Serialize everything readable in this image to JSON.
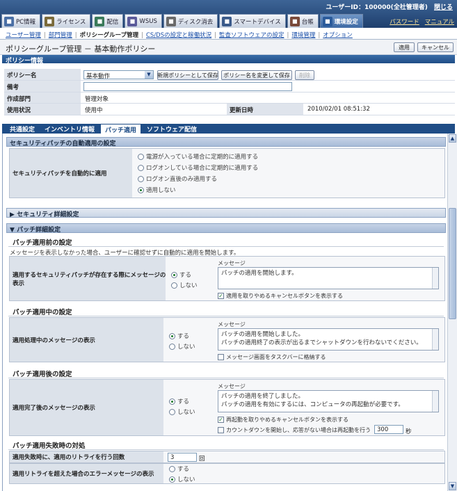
{
  "header": {
    "user_id": "ユーザーID：100000(全社管理者)",
    "close_link": "閉じる",
    "tabs": [
      {
        "label": "PC情報",
        "icon": "pc-icon",
        "color": "#4a6fa5"
      },
      {
        "label": "ライセンス",
        "icon": "license-icon",
        "color": "#7a6a3a"
      },
      {
        "label": "配信",
        "icon": "delivery-icon",
        "color": "#3a7a5a"
      },
      {
        "label": "WSUS",
        "icon": "wsus-icon",
        "color": "#5a5a9a"
      },
      {
        "label": "ディスク消去",
        "icon": "disk-erase-icon",
        "color": "#6a6a6a"
      },
      {
        "label": "スマートデバイス",
        "icon": "smart-device-icon",
        "color": "#3a5a8a"
      },
      {
        "label": "台帳",
        "icon": "ledger-icon",
        "color": "#7a4a3a"
      },
      {
        "label": "環境設定",
        "icon": "settings-icon",
        "color": "#2a5a9a"
      }
    ],
    "active_tab": "環境設定",
    "password_link": "パスワード",
    "manual_link": "マニュアル"
  },
  "subnav": {
    "items": [
      "ユーザー管理",
      "部門管理",
      "ポリシーグループ管理",
      "CS/DSの設定と稼働状況",
      "監査ソフトウェアの設定",
      "環境管理",
      "オプション"
    ],
    "current": "ポリシーグループ管理"
  },
  "page": {
    "title": "ポリシーグループ管理 － 基本動作ポリシー",
    "apply_label": "適用",
    "cancel_label": "キャンセル"
  },
  "policy_info": {
    "section_title": "ポリシー情報",
    "policy_name_label": "ポリシー名",
    "policy_name_value": "基本動作",
    "save_new_label": "新規ポリシーとして保存",
    "rename_save_label": "ポリシー名を変更して保存",
    "delete_label": "削除",
    "note_label": "備考",
    "note_value": "",
    "dept_label": "作成部門",
    "dept_value": "管理対象",
    "status_label": "使用状況",
    "status_value": "使用中",
    "updated_label": "更新日時",
    "updated_value": "2010/02/01 08:51:32"
  },
  "tabs2": {
    "items": [
      "共通設定",
      "インベントリ情報",
      "パッチ適用",
      "ソフトウェア配信"
    ],
    "active": "パッチ適用"
  },
  "auto_patch": {
    "title": "セキュリティパッチの自動適用の設定",
    "row_label": "セキュリティパッチを自動的に適用",
    "options": [
      "電源が入っている場合に定期的に適用する",
      "ログオンしている場合に定期的に適用する",
      "ログオン直後のみ適用する",
      "適用しない"
    ],
    "selected": 3
  },
  "security_detail": {
    "title": "セキュリティ詳細設定"
  },
  "patch_detail": {
    "title": "パッチ詳細設定",
    "before": {
      "title": "パッチ適用前の設定",
      "desc": "メッセージを表示しなかった場合、ユーザーに確認せずに自動的に適用を開始します。",
      "row_label": "適用するセキュリティパッチが存在する際にメッセージの表示",
      "yes_label": "する",
      "no_label": "しない",
      "message_label": "メッセージ",
      "message_text": "パッチの適用を開始します。",
      "check_label": "適用を取りやめるキャンセルボタンを表示する",
      "checked": true
    },
    "during": {
      "title": "パッチ適用中の設定",
      "row_label": "適用処理中のメッセージの表示",
      "yes_label": "する",
      "no_label": "しない",
      "message_label": "メッセージ",
      "message_line1": "パッチの適用を開始しました。",
      "message_line2": "パッチの適用終了の表示が出るまでシャットダウンを行わないでください。",
      "check_label": "メッセージ画面をタスクバーに格納する",
      "checked": false
    },
    "after": {
      "title": "パッチ適用後の設定",
      "row_label": "適用完了後のメッセージの表示",
      "yes_label": "する",
      "no_label": "しない",
      "message_label": "メッセージ",
      "message_line1": "パッチの適用を終了しました。",
      "message_line2": "パッチの適用を有効にするには、コンピュータの再起動が必要です。",
      "check1_label": "再起動を取りやめるキャンセルボタンを表示する",
      "check1_checked": true,
      "check2_label": "カウントダウンを開始し、応答がない場合は再起動を行う",
      "check2_checked": false,
      "countdown_value": "300",
      "countdown_unit": "秒"
    },
    "failure": {
      "title": "パッチ適用失敗時の対処",
      "retry_label": "適用失敗時に、適用のリトライを行う回数",
      "retry_value": "3",
      "retry_unit": "回",
      "err_label": "適用リトライを超えた場合のエラーメッセージの表示",
      "yes_label": "する",
      "no_label": "しない"
    }
  }
}
